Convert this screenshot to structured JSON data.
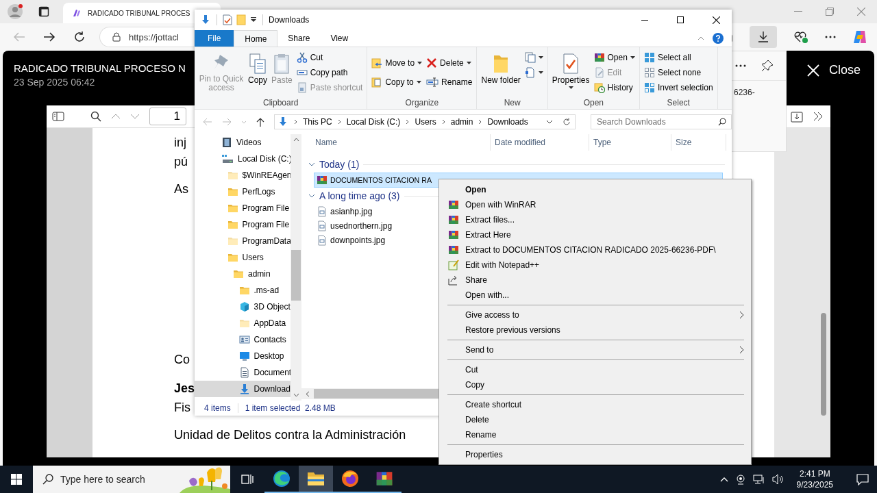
{
  "browser": {
    "tab_title": "RADICADO TRIBUNAL PROCES",
    "url": "https://jottacl",
    "download_item": "6236-"
  },
  "viewer": {
    "title": "RADICADO TRIBUNAL PROCESO N",
    "date": "23 Sep 2025 06:42",
    "close": "Close",
    "page_number": "1"
  },
  "pdf_lines": [
    {
      "text": "inj",
      "bold": false
    },
    {
      "text": "pú",
      "bold": false
    },
    {
      "text": "As",
      "bold": false
    },
    {
      "text": "Co",
      "bold": false
    },
    {
      "text": "Jes",
      "bold": true
    },
    {
      "text": "Fis",
      "bold": false
    },
    {
      "text": "Unidad de Delitos contra la Administración",
      "bold": false
    }
  ],
  "explorer": {
    "title": "Downloads",
    "ribbon_tabs": [
      {
        "label": "File",
        "kind": "file",
        "selected": false
      },
      {
        "label": "Home",
        "kind": "tab",
        "selected": true
      },
      {
        "label": "Share",
        "kind": "tab",
        "selected": false
      },
      {
        "label": "View",
        "kind": "tab",
        "selected": false
      }
    ],
    "ribbon_groups": [
      {
        "label": "Clipboard",
        "commands": [
          {
            "label": "Pin to Quick access",
            "kind": "large",
            "disabled": true,
            "dropdown": false
          },
          {
            "label": "Copy",
            "kind": "large",
            "disabled": false,
            "dropdown": false
          },
          {
            "label": "Paste",
            "kind": "large",
            "disabled": true,
            "dropdown": false
          },
          {
            "label": "Cut",
            "kind": "small",
            "disabled": false,
            "dropdown": false
          },
          {
            "label": "Copy path",
            "kind": "small",
            "disabled": false,
            "dropdown": false
          },
          {
            "label": "Paste shortcut",
            "kind": "small",
            "disabled": true,
            "dropdown": false
          }
        ]
      },
      {
        "label": "Organize",
        "commands": [
          {
            "label": "Move to",
            "kind": "small",
            "disabled": false,
            "dropdown": true
          },
          {
            "label": "Copy to",
            "kind": "small",
            "disabled": false,
            "dropdown": true
          },
          {
            "label": "Delete",
            "kind": "small",
            "disabled": false,
            "dropdown": true
          },
          {
            "label": "Rename",
            "kind": "small",
            "disabled": false,
            "dropdown": false
          }
        ]
      },
      {
        "label": "New",
        "commands": [
          {
            "label": "New folder",
            "kind": "large",
            "disabled": false,
            "dropdown": false
          },
          {
            "kind": "icon",
            "disabled": false,
            "dropdown": true
          },
          {
            "kind": "icon",
            "disabled": false,
            "dropdown": true
          }
        ]
      },
      {
        "label": "Open",
        "commands": [
          {
            "label": "Properties",
            "kind": "large",
            "disabled": false,
            "dropdown": true
          },
          {
            "label": "Open",
            "kind": "small",
            "disabled": false,
            "dropdown": true
          },
          {
            "label": "Edit",
            "kind": "small",
            "disabled": true,
            "dropdown": false
          },
          {
            "label": "History",
            "kind": "small",
            "disabled": false,
            "dropdown": false
          }
        ]
      },
      {
        "label": "Select",
        "commands": [
          {
            "label": "Select all",
            "kind": "small",
            "disabled": false,
            "dropdown": false
          },
          {
            "label": "Select none",
            "kind": "small",
            "disabled": false,
            "dropdown": false
          },
          {
            "label": "Invert selection",
            "kind": "small",
            "disabled": false,
            "dropdown": false
          }
        ]
      }
    ],
    "breadcrumb": [
      "This PC",
      "Local Disk (C:)",
      "Users",
      "admin",
      "Downloads"
    ],
    "search": {
      "placeholder": "Search Downloads"
    },
    "nav": [
      {
        "label": "Videos",
        "kind": "videos",
        "hidden": false,
        "selected": false
      },
      {
        "label": "Local Disk (C:)",
        "kind": "drive",
        "hidden": false,
        "selected": false,
        "children": [
          {
            "label": "$WinREAgen",
            "kind": "folder",
            "hidden": true,
            "selected": false
          },
          {
            "label": "PerfLogs",
            "kind": "folder",
            "hidden": false,
            "selected": false
          },
          {
            "label": "Program File",
            "kind": "folder",
            "hidden": false,
            "selected": false
          },
          {
            "label": "Program File",
            "kind": "folder",
            "hidden": false,
            "selected": false
          },
          {
            "label": "ProgramData",
            "kind": "folder",
            "hidden": true,
            "selected": false
          },
          {
            "label": "Users",
            "kind": "folder",
            "hidden": false,
            "selected": false,
            "children": [
              {
                "label": "admin",
                "kind": "folder",
                "hidden": false,
                "selected": false,
                "children": [
                  {
                    "label": ".ms-ad",
                    "kind": "folder",
                    "hidden": false,
                    "selected": false
                  },
                  {
                    "label": "3D Object",
                    "kind": "cube",
                    "hidden": false,
                    "selected": false
                  },
                  {
                    "label": "AppData",
                    "kind": "folder",
                    "hidden": true,
                    "selected": false
                  },
                  {
                    "label": "Contacts",
                    "kind": "contacts",
                    "hidden": false,
                    "selected": false
                  },
                  {
                    "label": "Desktop",
                    "kind": "desktop",
                    "hidden": false,
                    "selected": false
                  },
                  {
                    "label": "Document",
                    "kind": "document",
                    "hidden": false,
                    "selected": false
                  },
                  {
                    "label": "Download",
                    "kind": "download",
                    "hidden": false,
                    "selected": true
                  }
                ]
              }
            ]
          }
        ]
      }
    ],
    "columns": [
      "Name",
      "Date modified",
      "Type",
      "Size"
    ],
    "groups": [
      {
        "label": "Today (1)",
        "expanded": true,
        "items": [
          {
            "name": "DOCUMENTOS CITACION RA",
            "kind": "archive",
            "selected": true
          }
        ]
      },
      {
        "label": "A long time ago (3)",
        "expanded": true,
        "items": [
          {
            "name": "asianhp.jpg",
            "kind": "image",
            "selected": false
          },
          {
            "name": "usednorthern.jpg",
            "kind": "image",
            "selected": false
          },
          {
            "name": "downpoints.jpg",
            "kind": "image",
            "selected": false
          }
        ]
      }
    ],
    "status": {
      "count": "4 items",
      "selection": "1 item selected  2.48 MB"
    }
  },
  "context_menu": [
    {
      "label": "Open",
      "kind": "plain",
      "default": true,
      "submenu": false
    },
    {
      "label": "Open with WinRAR",
      "kind": "winrar",
      "default": false,
      "submenu": false
    },
    {
      "label": "Extract files...",
      "kind": "winrar",
      "default": false,
      "submenu": false
    },
    {
      "label": "Extract Here",
      "kind": "winrar",
      "default": false,
      "submenu": false
    },
    {
      "label": "Extract to DOCUMENTOS CITACION RADICADO 2025-66236-PDF\\",
      "kind": "winrar",
      "default": false,
      "submenu": false
    },
    {
      "label": "Edit with Notepad++",
      "kind": "notepad",
      "default": false,
      "submenu": false
    },
    {
      "label": "Share",
      "kind": "share",
      "default": false,
      "submenu": false
    },
    {
      "label": "Open with...",
      "kind": "plain",
      "default": false,
      "submenu": false
    },
    {
      "kind": "separator"
    },
    {
      "label": "Give access to",
      "kind": "plain",
      "default": false,
      "submenu": true
    },
    {
      "label": "Restore previous versions",
      "kind": "plain",
      "default": false,
      "submenu": false
    },
    {
      "kind": "separator"
    },
    {
      "label": "Send to",
      "kind": "plain",
      "default": false,
      "submenu": true
    },
    {
      "kind": "separator"
    },
    {
      "label": "Cut",
      "kind": "plain",
      "default": false,
      "submenu": false
    },
    {
      "label": "Copy",
      "kind": "plain",
      "default": false,
      "submenu": false
    },
    {
      "kind": "separator"
    },
    {
      "label": "Create shortcut",
      "kind": "plain",
      "default": false,
      "submenu": false
    },
    {
      "label": "Delete",
      "kind": "plain",
      "default": false,
      "submenu": false
    },
    {
      "label": "Rename",
      "kind": "plain",
      "default": false,
      "submenu": false
    },
    {
      "kind": "separator"
    },
    {
      "label": "Properties",
      "kind": "plain",
      "default": false,
      "submenu": false
    }
  ],
  "taskbar": {
    "search": {
      "placeholder": "Type here to search"
    },
    "apps": [
      {
        "kind": "taskview",
        "running": false,
        "active": false
      },
      {
        "kind": "edge",
        "running": true,
        "active": false
      },
      {
        "kind": "explorer",
        "running": true,
        "active": true
      },
      {
        "kind": "firefox",
        "running": true,
        "active": false
      },
      {
        "kind": "winrar",
        "running": true,
        "active": false
      }
    ],
    "time": "2:41 PM",
    "date": "9/23/2025"
  }
}
